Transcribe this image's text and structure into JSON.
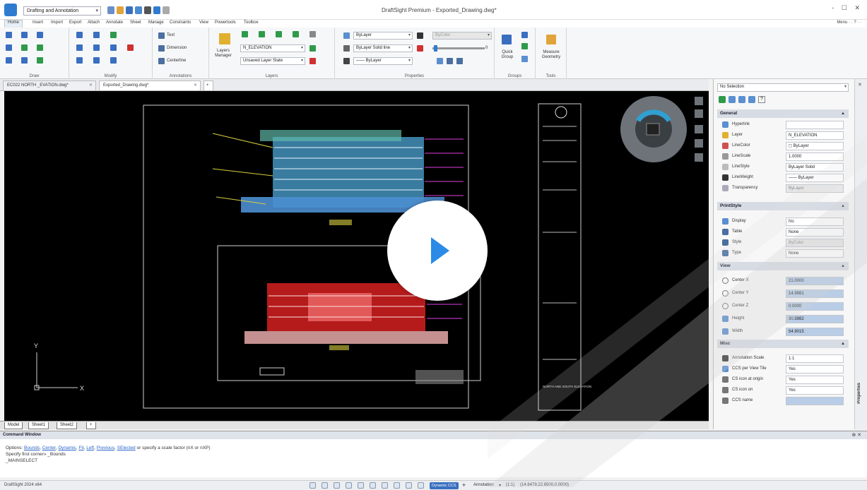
{
  "titlebar": {
    "workspace": "Drafting and Annotation",
    "title": "DraftSight Premium - Exported_Drawing.dwg*",
    "controls": "- ☐ ✕"
  },
  "ribbon_tabs": [
    "Home",
    "Insert",
    "Import",
    "Export",
    "Attach",
    "Annotate",
    "Sheet",
    "Manage",
    "Constraints",
    "View",
    "Powertools",
    "Toolbox"
  ],
  "menu_help": "Menu ·  ·  ?  ·  ·",
  "ribbon": {
    "groups": {
      "draw": "Draw",
      "modify": "Modify",
      "annotations": "Annotations",
      "layers": "Layers",
      "properties": "Properties",
      "groups": "Groups",
      "tools": "Tools"
    },
    "annotations": {
      "text": "Text",
      "dimension": "Dimension",
      "centerline": "Centerline"
    },
    "layers": {
      "manager_label": "Layers Manager",
      "layer_combo": "N_ELEVATION",
      "state_combo": "Unsaved Layer State"
    },
    "properties": {
      "color_combo": "ByLayer",
      "bycolor": "ByColor",
      "linestyle_combo": "ByLayer   Solid line",
      "lineweight_combo": "—— ByLayer",
      "transparency_value": "0"
    },
    "groups_tool": {
      "quick_group": "Quick Group"
    },
    "tools": {
      "measure": "Measure Geometry"
    }
  },
  "doc_tabs": [
    {
      "label": "EC022 NORTH _EVATION.dwg*"
    },
    {
      "label": "Exported_Drawing.dwg*"
    }
  ],
  "sheet_tabs": [
    "Model",
    "Sheet1",
    "Sheet2"
  ],
  "command_window": {
    "title": "Command Window",
    "options_prefix": "Options:",
    "options_links": [
      "Bounds",
      "Center",
      "Dynamic",
      "Fit",
      "Left",
      "Previous",
      "SElected"
    ],
    "options_suffix": "or specify a scale factor (nX or nXP)",
    "line2": "Specify first corner» _Bounds",
    "line3": "_MAINSELECT"
  },
  "statusbar": {
    "version": "DraftSight 2024 x64",
    "dynamic_ccs": "Dynamic CCS",
    "annotation": "Annotation",
    "scale": "(1:1)",
    "coords": "(14.6479,22.8500,0.0000)"
  },
  "properties": {
    "selection": "No Selection",
    "sections": {
      "general": "General",
      "printstyle": "PrintStyle",
      "view": "View",
      "misc": "Misc"
    },
    "general": [
      {
        "label": "Hyperlink",
        "value": ""
      },
      {
        "label": "Layer",
        "value": "N_ELEVATION"
      },
      {
        "label": "LineColor",
        "value": "◻ ByLayer"
      },
      {
        "label": "LineScale",
        "value": "1.0000"
      },
      {
        "label": "LineStyle",
        "value": "ByLayer    Solid"
      },
      {
        "label": "LineWeight",
        "value": "—— ByLayer"
      },
      {
        "label": "Transparency",
        "value": "ByLayer"
      }
    ],
    "printstyle": [
      {
        "label": "Display",
        "value": "No"
      },
      {
        "label": "Table",
        "value": "None"
      },
      {
        "label": "Style",
        "value": "ByColor"
      },
      {
        "label": "Type",
        "value": "None"
      }
    ],
    "view": [
      {
        "label": "Center X",
        "value": "21.0000"
      },
      {
        "label": "Center Y",
        "value": "14.9981"
      },
      {
        "label": "Center Z",
        "value": "0.0000"
      },
      {
        "label": "Height",
        "value": "30.5982"
      },
      {
        "label": "Width",
        "value": "54.9015"
      }
    ],
    "misc": [
      {
        "label": "Annotation Scale",
        "value": "1:1"
      },
      {
        "label": "CCS per View Tile",
        "value": "Yes"
      },
      {
        "label": "CS icon at origin",
        "value": "Yes"
      },
      {
        "label": "CS icon on",
        "value": "Yes"
      },
      {
        "label": "CCS name",
        "value": ""
      }
    ]
  },
  "rail": {
    "properties": "Properties"
  },
  "drawing": {
    "sheet_title": "NORTH AND SOUTH ELEVATION",
    "axis_x": "X",
    "axis_y": "Y"
  },
  "colors": {
    "canvas": "#000000",
    "elev_top": "#4da6d6",
    "elev_bottom": "#d62020",
    "magenta": "#e040e0",
    "yellow": "#d8d040",
    "accent": "#2b8be6"
  }
}
